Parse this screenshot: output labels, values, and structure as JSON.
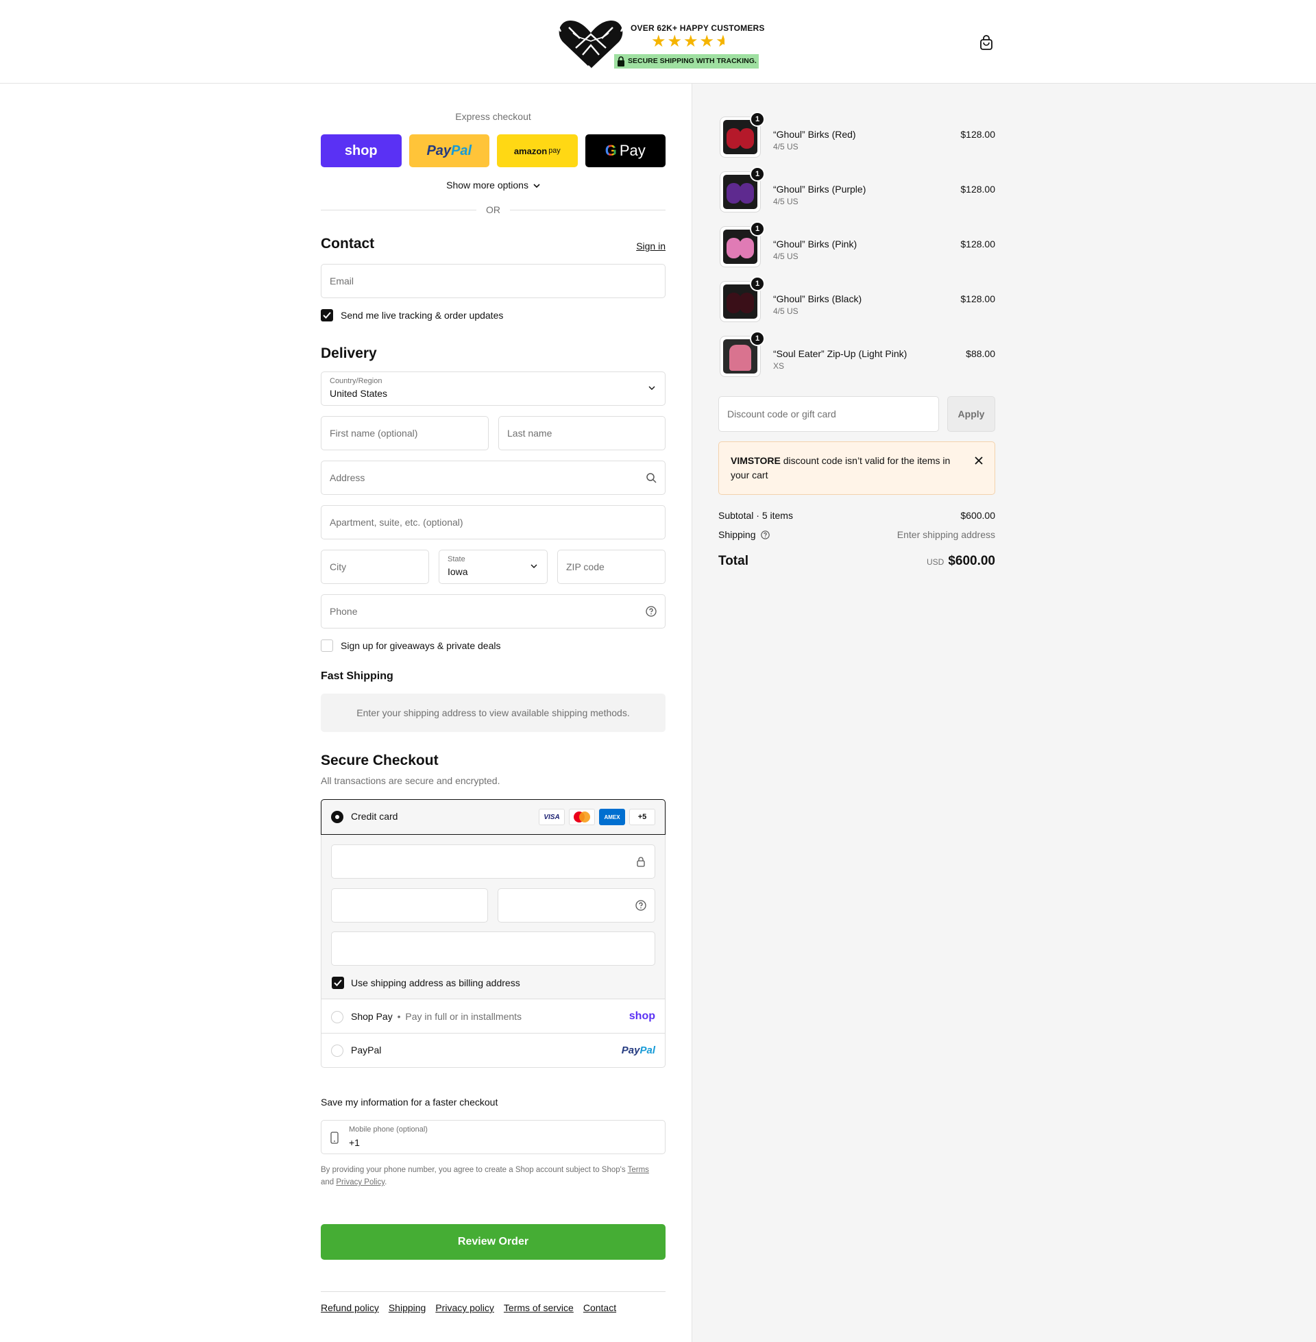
{
  "header": {
    "tagline": "OVER 62K+ HAPPY CUSTOMERS",
    "rating_stars": 4.5,
    "badge": "SECURE SHIPPING WITH TRACKING."
  },
  "express": {
    "title": "Express checkout",
    "shop_label": "shop",
    "paypal_label_1": "Pay",
    "paypal_label_2": "Pal",
    "amazon_label": "amazon",
    "amazon_label_2": "pay",
    "gpay_g": "G",
    "gpay_label": "Pay",
    "more_options": "Show more options",
    "or": "OR"
  },
  "contact": {
    "title": "Contact",
    "sign_in": "Sign in",
    "email_placeholder": "Email",
    "tracking_checkbox_label": "Send me live tracking & order updates"
  },
  "delivery": {
    "title": "Delivery",
    "country_label": "Country/Region",
    "country_value": "United States",
    "first_name_placeholder": "First name (optional)",
    "last_name_placeholder": "Last name",
    "address_placeholder": "Address",
    "apartment_placeholder": "Apartment, suite, etc. (optional)",
    "city_placeholder": "City",
    "state_label": "State",
    "state_value": "Iowa",
    "zip_placeholder": "ZIP code",
    "phone_placeholder": "Phone",
    "giveaways_label": "Sign up for giveaways & private deals"
  },
  "shipping": {
    "title": "Fast Shipping",
    "message": "Enter your shipping address to view available shipping methods."
  },
  "payment": {
    "title": "Secure Checkout",
    "subtitle": "All transactions are secure and encrypted.",
    "credit_card_label": "Credit card",
    "card_logos": [
      "VISA",
      "mastercard",
      "AMEX",
      "+5"
    ],
    "billing_checkbox_label": "Use shipping address as billing address",
    "shop_pay_label": "Shop Pay",
    "shop_pay_sep": "•",
    "shop_pay_note": "Pay in full or in installments",
    "shop_pay_logo": "shop",
    "paypal_label": "PayPal",
    "paypal_logo_1": "Pay",
    "paypal_logo_2": "Pal"
  },
  "save_info": {
    "title": "Save my information for a faster checkout",
    "mobile_label": "Mobile phone (optional)",
    "mobile_value": "+1",
    "terms_prefix": "By providing your phone number, you agree to create a Shop account subject to Shop's",
    "terms_link": "Terms",
    "terms_and": "and",
    "privacy_link": "Privacy Policy",
    "terms_end": "."
  },
  "review_button": "Review Order",
  "footer_links": [
    "Refund policy",
    "Shipping",
    "Privacy policy",
    "Terms of service",
    "Contact"
  ],
  "cart": {
    "items": [
      {
        "name": "“Ghoul” Birks (Red)",
        "variant": "4/5 US",
        "price": "$128.00",
        "qty": "1",
        "color": "#b5192a"
      },
      {
        "name": "“Ghoul” Birks (Purple)",
        "variant": "4/5 US",
        "price": "$128.00",
        "qty": "1",
        "color": "#5e2a8f"
      },
      {
        "name": "“Ghoul” Birks (Pink)",
        "variant": "4/5 US",
        "price": "$128.00",
        "qty": "1",
        "color": "#e07bb5"
      },
      {
        "name": "“Ghoul” Birks (Black)",
        "variant": "4/5 US",
        "price": "$128.00",
        "qty": "1",
        "color": "#3a0f18"
      },
      {
        "name": "“Soul Eater” Zip-Up (Light Pink)",
        "variant": "XS",
        "price": "$88.00",
        "qty": "1",
        "color": "#d9738f"
      }
    ],
    "discount_placeholder": "Discount code or gift card",
    "apply_label": "Apply",
    "notice_code": "VIMSTORE",
    "notice_text": "discount code isn’t valid for the items in your cart",
    "subtotal_label": "Subtotal · 5 items",
    "subtotal_value": "$600.00",
    "shipping_label": "Shipping",
    "shipping_value": "Enter shipping address",
    "total_label": "Total",
    "total_currency": "USD",
    "total_value": "$600.00"
  },
  "colors": {
    "review_button": "#45ad34",
    "shop_pay": "#5a31f4",
    "paypal": "#ffc439",
    "amazon_pay": "#ffd814",
    "notice_bg": "#fff4e8"
  }
}
